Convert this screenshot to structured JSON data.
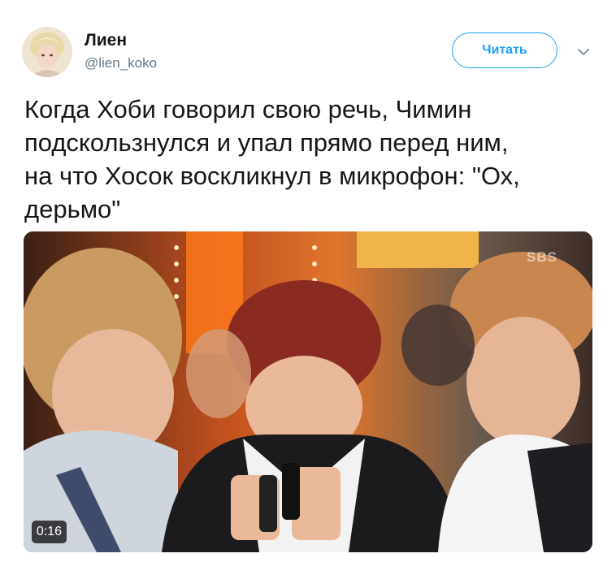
{
  "user": {
    "name": "Лиен",
    "handle": "@lien_koko"
  },
  "follow_button": {
    "label": "Читать"
  },
  "tweet": {
    "text": "Когда Хоби говорил свою речь, Чимин\nподскользнулся и упал прямо перед ним,\nна что Хосок воскликнул в микрофон: \"Ох,\nдерьмо\""
  },
  "video": {
    "duration": "0:16",
    "watermark": "SBS"
  },
  "icons": {
    "menu": "chevron-down-icon",
    "avatar": "avatar-image"
  },
  "colors": {
    "accent": "#1da1f2",
    "text": "#14171a",
    "muted": "#657786"
  }
}
